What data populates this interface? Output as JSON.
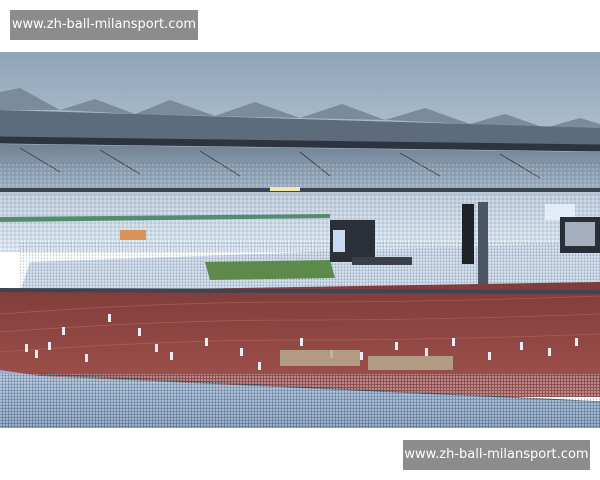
{
  "watermarks": {
    "top": "www.zh-ball-milansport.com",
    "bottom": "www.zh-ball-milansport.com"
  },
  "photo": {
    "subject": "stadium-concert-night-crowd",
    "colors": {
      "sky": "#9fb3c6",
      "roof": "#6c7d8e",
      "crowd": "#c9d6e6",
      "track": "#9a4a45",
      "pitch": "#5d8a4a",
      "stage": "#2b2f38"
    }
  }
}
